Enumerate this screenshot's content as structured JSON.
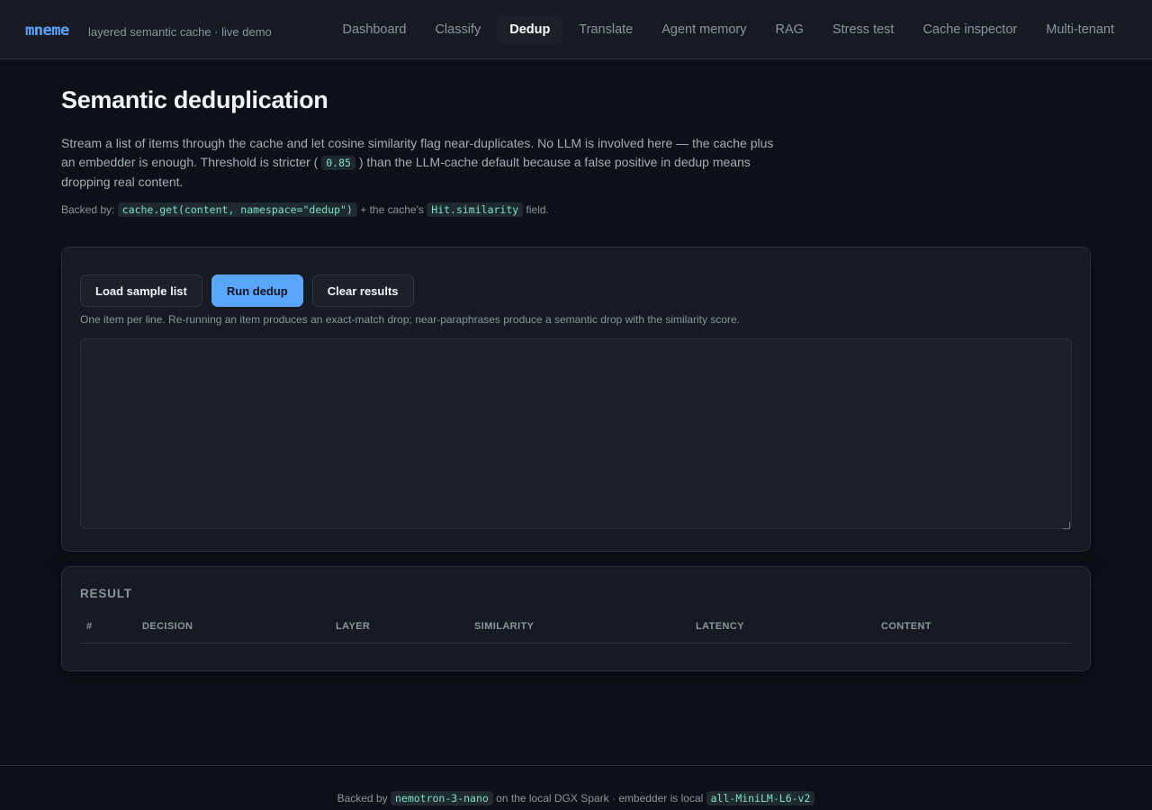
{
  "header": {
    "brand": "mneme",
    "tagline": "layered semantic cache · live demo",
    "nav": [
      {
        "label": "Dashboard"
      },
      {
        "label": "Classify"
      },
      {
        "label": "Dedup"
      },
      {
        "label": "Translate"
      },
      {
        "label": "Agent memory"
      },
      {
        "label": "RAG"
      },
      {
        "label": "Stress test"
      },
      {
        "label": "Cache inspector"
      },
      {
        "label": "Multi-tenant"
      }
    ],
    "active": "Dedup"
  },
  "page": {
    "title": "Semantic deduplication",
    "intro_part1": "Stream a list of items through the cache and let cosine similarity flag near-duplicates. No LLM is involved here — the cache plus an embedder is enough. Threshold is stricter (",
    "threshold": "0.85",
    "intro_part2": ") than the LLM-cache default because a false positive in dedup means dropping real content.",
    "backed_prefix": "Backed by:",
    "backed_code1": "cache.get(content, namespace=\"dedup\")",
    "backed_mid": "+ the cache's",
    "backed_code2": "Hit.similarity",
    "backed_suffix": "field."
  },
  "controls": {
    "load_label": "Load sample list",
    "run_label": "Run dedup",
    "clear_label": "Clear results",
    "hint": "One item per line. Re-running an item produces an exact-match drop; near-paraphrases produce a semantic drop with the similarity score.",
    "textarea_value": ""
  },
  "result": {
    "title": "RESULT",
    "columns": [
      "#",
      "DECISION",
      "LAYER",
      "SIMILARITY",
      "LATENCY",
      "CONTENT"
    ],
    "rows": []
  },
  "footer": {
    "prefix": "Backed by",
    "model": "nemotron-3-nano",
    "middle": "on the local DGX Spark · embedder is local",
    "embedder": "all-MiniLM-L6-v2"
  }
}
